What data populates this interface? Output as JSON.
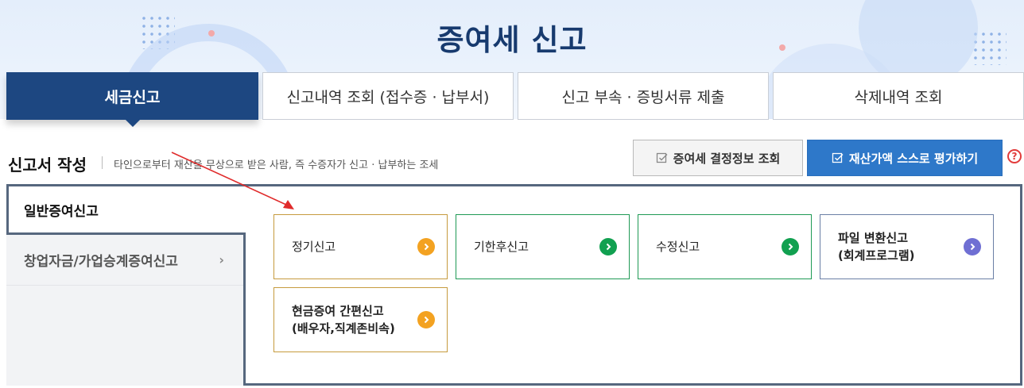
{
  "header": {
    "title": "증여세 신고"
  },
  "tabs": [
    {
      "label": "세금신고",
      "active": true
    },
    {
      "label": "신고내역 조회 (접수증 · 납부서)",
      "active": false
    },
    {
      "label": "신고 부속 · 증빙서류 제출",
      "active": false
    },
    {
      "label": "삭제내역 조회",
      "active": false
    }
  ],
  "section": {
    "title": "신고서 작성",
    "description": "타인으로부터 재산을 무상으로 받은 사람, 즉 수증자가 신고 · 납부하는 조세",
    "buttons": {
      "decision_lookup": "증여세 결정정보 조회",
      "self_evaluate": "재산가액 스스로 평가하기"
    },
    "help_icon": "?"
  },
  "sidebar": {
    "items": [
      {
        "label": "일반증여신고",
        "active": true
      },
      {
        "label": "창업자금/가업승계증여신고",
        "active": false,
        "chevron": "›"
      }
    ]
  },
  "cards": [
    {
      "label": "정기신고",
      "accent": "#f3a221",
      "icon": "chevron-right-icon"
    },
    {
      "label": "기한후신고",
      "accent": "#11a050",
      "icon": "chevron-right-icon"
    },
    {
      "label": "수정신고",
      "accent": "#11a050",
      "icon": "chevron-right-icon"
    },
    {
      "label": "파일 변환신고 (회계프로그램)",
      "line1": "파일 변환신고",
      "line2": "(회계프로그램)",
      "accent": "#6f6fd3",
      "icon": "chevron-right-icon"
    },
    {
      "label": "현금증여 간편신고 (배우자,직계존비속)",
      "line1": "현금증여 간편신고",
      "line2": "(배우자,직계존비속)",
      "accent": "#f3a221",
      "icon": "chevron-right-icon"
    }
  ],
  "colors": {
    "primary_navy": "#1d4781",
    "button_blue": "#2e78c9",
    "annotation_red": "#e02b2b"
  }
}
